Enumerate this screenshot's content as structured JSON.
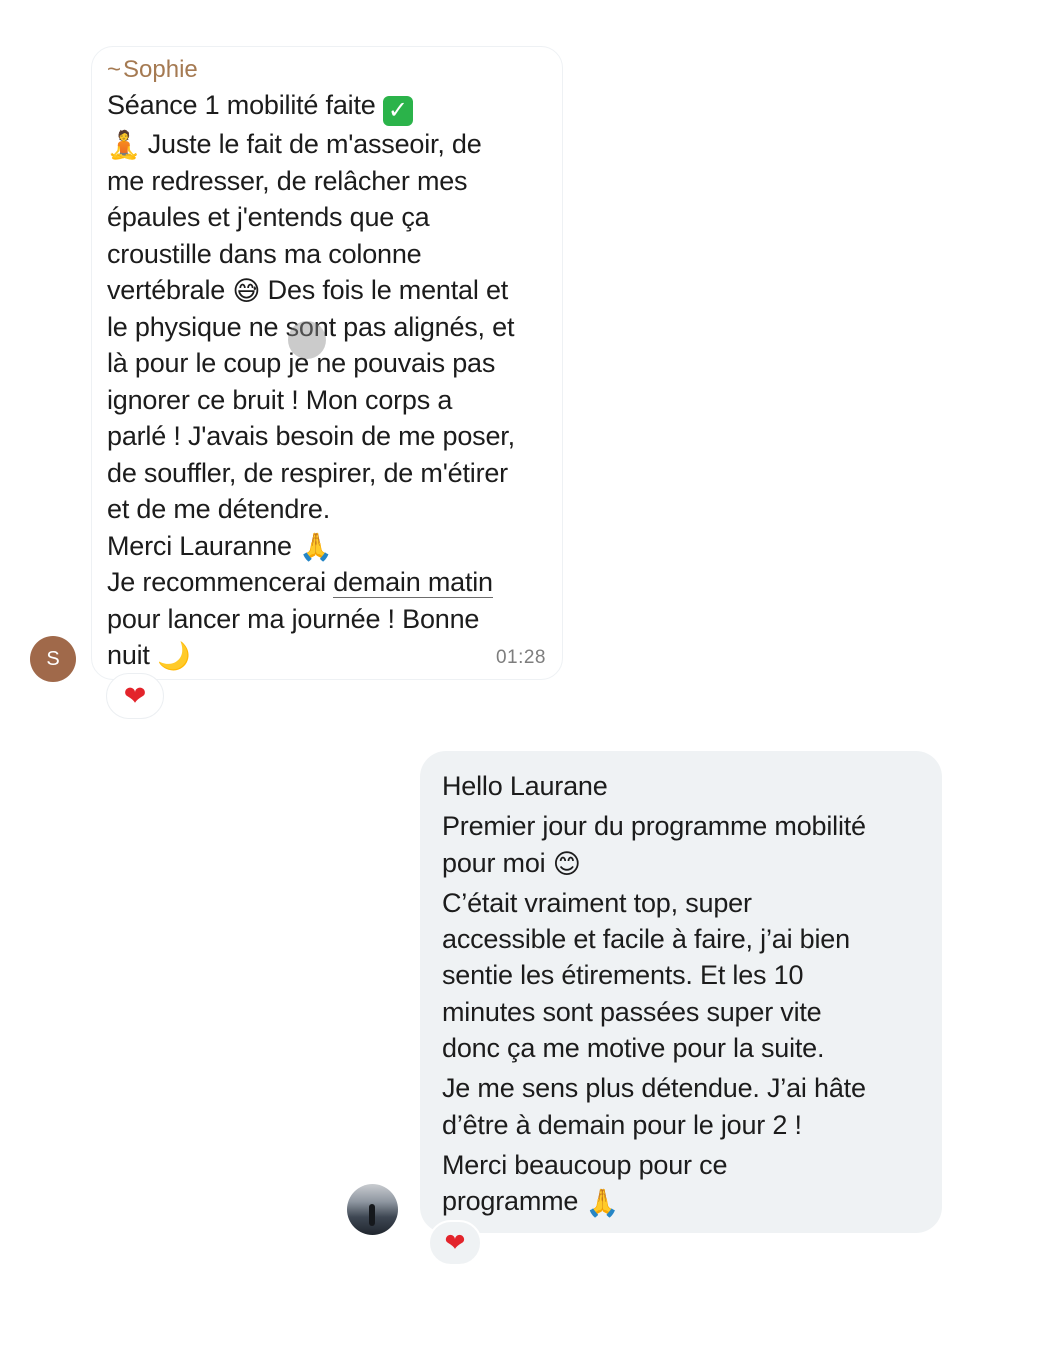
{
  "message1": {
    "sender": "Sophie",
    "sender_prefix": "~",
    "lines": [
      "Séance 1 mobilité faite",
      "Juste le fait de m'asseoir, de",
      "me redresser, de relâcher mes",
      "épaules et j'entends que ça",
      "croustille dans ma colonne",
      "vertébrale",
      "Des fois le mental et",
      "le physique ne sont pas alignés, et",
      "là pour le coup je ne pouvais pas",
      "ignorer ce bruit ! Mon corps a",
      "parlé ! J'avais besoin de me poser,",
      "de souffler, de respirer, de m'étirer",
      "et de me détendre.",
      "Merci Lauranne",
      "Je recommencerai ",
      "demain matin",
      "pour lancer ma journée ! Bonne",
      "nuit"
    ],
    "emojis": {
      "check": "✓",
      "meditation": "🧘",
      "sweat_smile": "😅",
      "pray": "🙏",
      "moon": "🌙"
    },
    "time": "01:28",
    "avatar_initial": "S",
    "reaction": "❤",
    "avatar_color": "#a0694a",
    "sender_color": "#a57a52"
  },
  "message2": {
    "lines": [
      "Hello Laurane",
      "Premier jour du programme mobilité",
      "pour moi",
      "C’était vraiment top, super",
      "accessible et facile à faire, j’ai bien",
      "sentie les étirements. Et les 10",
      "minutes sont passées super vite",
      "donc ça me motive pour la suite.",
      "Je me sens plus détendue. J’ai hâte",
      "d’être à demain pour le jour 2 !",
      "Merci beaucoup pour ce",
      "programme"
    ],
    "emojis": {
      "smile": "😊",
      "pray": "🙏"
    },
    "reaction": "❤",
    "bubble_color": "#eff2f4"
  }
}
